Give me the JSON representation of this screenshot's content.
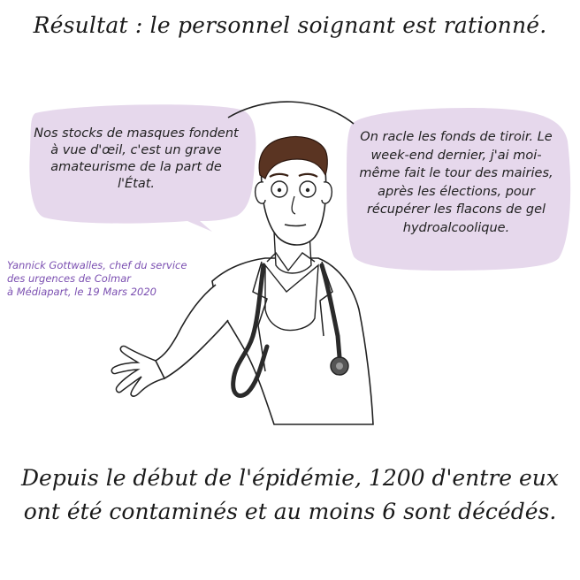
{
  "title": "Résultat : le personnel soignant est rationné.",
  "left_bubble": {
    "text": "Nos stocks de masques fondent à vue d'œil, c'est un grave amateurisme de la part de l'État."
  },
  "right_bubble": {
    "text": "On racle les fonds de tiroir. Le week-end dernier, j'ai moi-même fait le tour des mairies, après les élections, pour récupérer les flacons de gel hydroalcoolique."
  },
  "caption": {
    "line1": "Yannick Gottwalles, chef du service",
    "line2": "des urgences de Colmar",
    "line3": "à Médiapart, le 19 Mars 2020"
  },
  "bottom_text": "Depuis le début de l'épidémie, 1200 d'entre eux ont été contaminés et au moins 6 sont décédés.",
  "colors": {
    "bubble_fill": "#e6d8ec",
    "caption_text": "#7b4fb1",
    "hair": "#5a3422"
  }
}
